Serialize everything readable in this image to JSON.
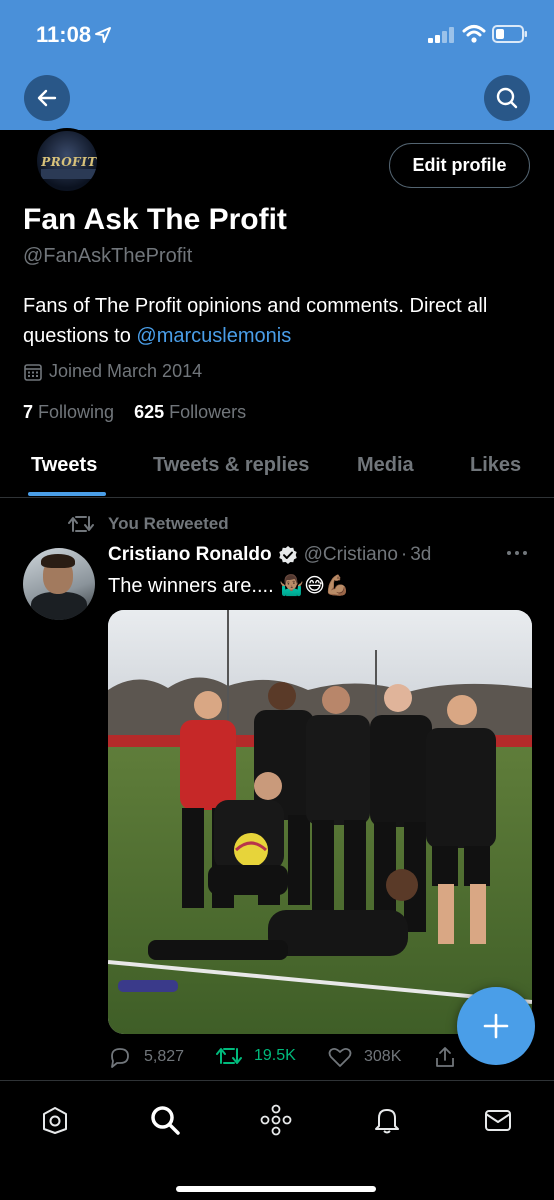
{
  "status_bar": {
    "time": "11:08"
  },
  "header": {
    "back_icon": "arrow-left-icon",
    "search_icon": "search-icon"
  },
  "profile": {
    "avatar_text": "PROFIT",
    "edit_button": "Edit profile",
    "name": "Fan Ask The Profit",
    "handle": "@FanAskTheProfit",
    "bio_text": "Fans of The Profit opinions and comments. Direct all questions to ",
    "bio_mention": "@marcuslemonis",
    "joined": "Joined March 2014",
    "following_count": "7",
    "following_label": "Following",
    "followers_count": "625",
    "followers_label": "Followers"
  },
  "tabs": [
    {
      "label": "Tweets",
      "active": true
    },
    {
      "label": "Tweets & replies",
      "active": false
    },
    {
      "label": "Media",
      "active": false
    },
    {
      "label": "Likes",
      "active": false
    }
  ],
  "tweet": {
    "retweet_label": "You Retweeted",
    "author_name": "Cristiano Ronaldo",
    "author_handle": "@Cristiano",
    "separator": "·",
    "time": "3d",
    "text": "The winners are.... 🤷🏽‍♂️😅💪🏽",
    "replies": "5,827",
    "retweets": "19.5K",
    "likes": "308K"
  },
  "colors": {
    "accent": "#4a9ee8",
    "banner": "#4a90d9",
    "retweet_green": "#00ba7c"
  },
  "bottom_nav": [
    "home-icon",
    "search-icon",
    "spaces-icon",
    "notifications-icon",
    "messages-icon"
  ]
}
